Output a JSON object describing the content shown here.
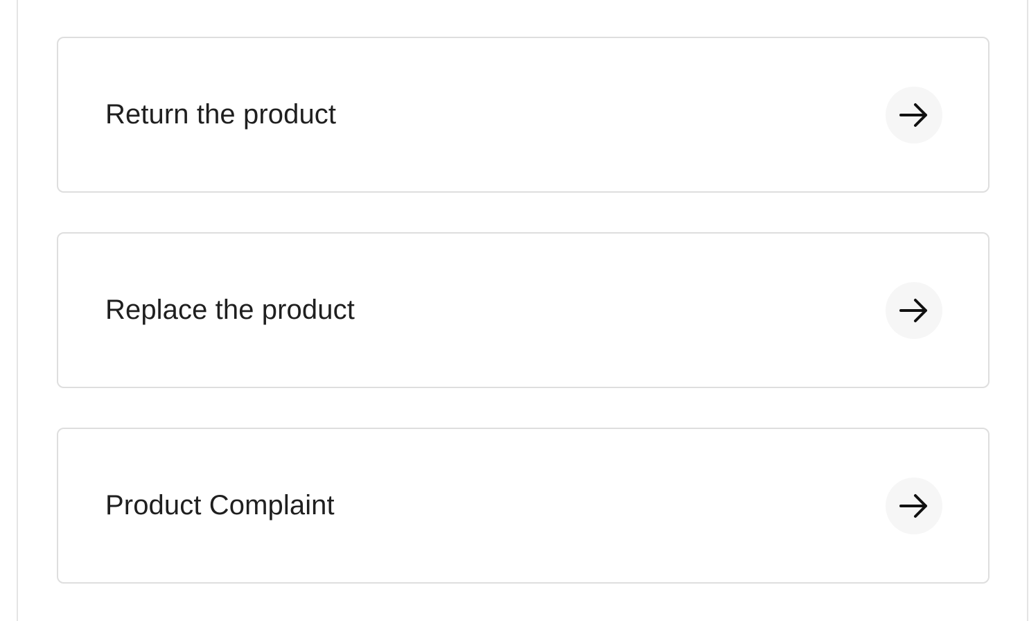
{
  "options": [
    {
      "label": "Return the product",
      "icon": "arrow-right-icon"
    },
    {
      "label": "Replace the product",
      "icon": "arrow-right-icon"
    },
    {
      "label": "Product Complaint",
      "icon": "arrow-right-icon"
    }
  ],
  "colors": {
    "card_border": "#dedede",
    "text": "#1f1f1f",
    "icon_bg": "#f6f6f6",
    "icon_stroke": "#111111"
  }
}
